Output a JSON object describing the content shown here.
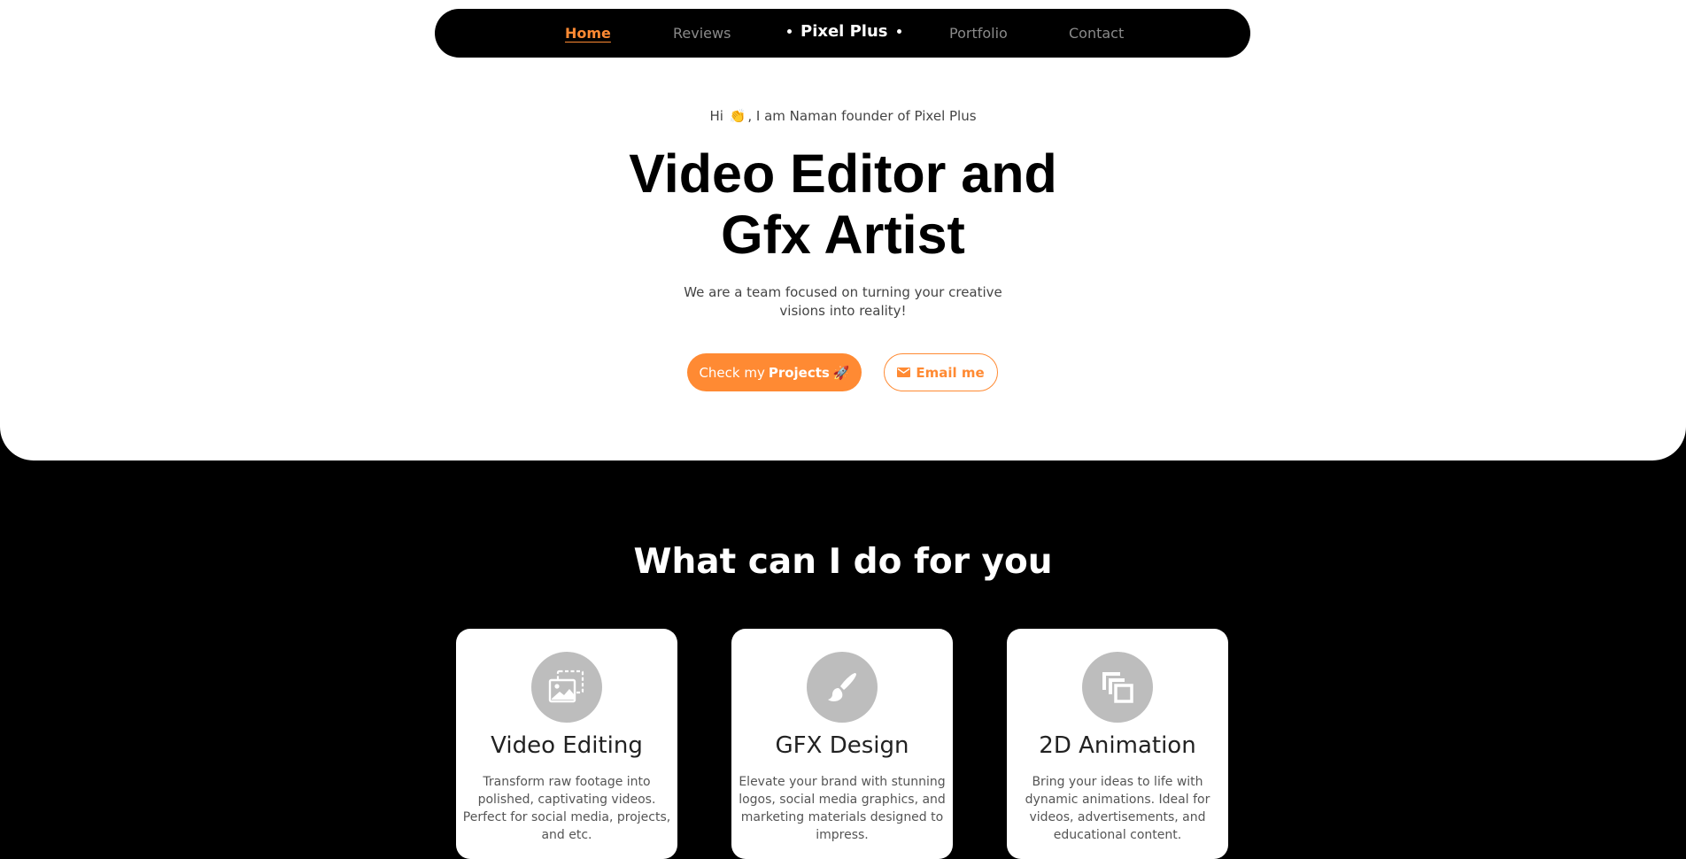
{
  "nav": {
    "home": "Home",
    "reviews": "Reviews",
    "brand": "Pixel Plus",
    "portfolio": "Portfolio",
    "contact": "Contact"
  },
  "hero": {
    "greeting_before": "Hi",
    "greeting_after": ", I am Naman founder of Pixel Plus",
    "headline_line1": "Video Editor and",
    "headline_line2": "Gfx Artist",
    "subtext": "We are a team focused on turning your creative visions into reality!",
    "projects_button_prefix": "Check my",
    "projects_button_bold": "Projects",
    "email_button": "Email me"
  },
  "services": {
    "title": "What can I do for you",
    "cards": [
      {
        "icon": "images-icon",
        "title": "Video Editing",
        "description": "Transform raw footage into polished, captivating videos. Perfect for social media, projects, and etc."
      },
      {
        "icon": "brush-icon",
        "title": "GFX Design",
        "description": "Elevate your brand with stunning logos, social media graphics, and marketing materials designed to impress."
      },
      {
        "icon": "layers-icon",
        "title": "2D Animation",
        "description": "Bring your ideas to life with dynamic animations. Ideal for videos, advertisements, and educational content."
      }
    ]
  },
  "colors": {
    "accent": "#ff8a33",
    "dark": "#000000",
    "icon_circle": "#bdbdbd"
  }
}
